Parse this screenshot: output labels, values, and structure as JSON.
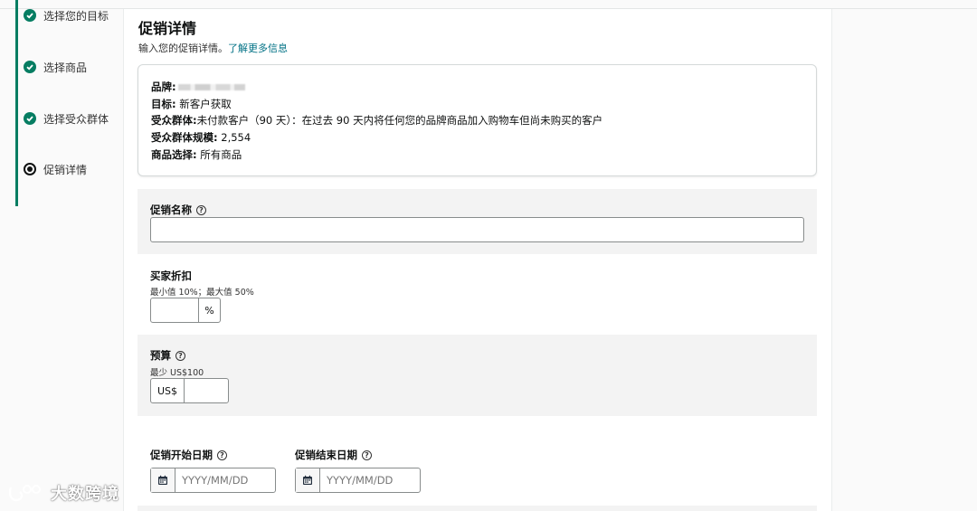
{
  "stepper": {
    "steps": [
      {
        "label": "选择您的目标",
        "state": "done"
      },
      {
        "label": "选择商品",
        "state": "done"
      },
      {
        "label": "选择受众群体",
        "state": "done"
      },
      {
        "label": "促销详情",
        "state": "current"
      }
    ]
  },
  "header": {
    "title": "促销详情",
    "subtitle": "输入您的促销详情。",
    "learn_more": "了解更多信息"
  },
  "summary": {
    "brand_label": "品牌:",
    "goal_label": "目标:",
    "goal_value": "新客户获取",
    "audience_label": "受众群体:",
    "audience_value": "未付款客户（90 天）：在过去 90 天内将任何您的品牌商品加入购物车但尚未购买的客户",
    "size_label": "受众群体规模:",
    "size_value": "2,554",
    "products_label": "商品选择:",
    "products_value": "所有商品"
  },
  "form": {
    "promo_name": {
      "label": "促销名称",
      "value": ""
    },
    "discount": {
      "label": "买家折扣",
      "hint": "最小值 10%；最大值 50%",
      "suffix": "%",
      "value": ""
    },
    "budget": {
      "label": "预算",
      "hint": "最少 US$100",
      "prefix": "US$",
      "value": ""
    },
    "start_date": {
      "label": "促销开始日期",
      "placeholder": "YYYY/MM/DD"
    },
    "end_date": {
      "label": "促销结束日期",
      "placeholder": "YYYY/MM/DD"
    }
  },
  "watermark": {
    "text": "大数跨境"
  },
  "colors": {
    "accent": "#067d62",
    "link": "#007185",
    "section_bg": "#f3f3f3"
  }
}
